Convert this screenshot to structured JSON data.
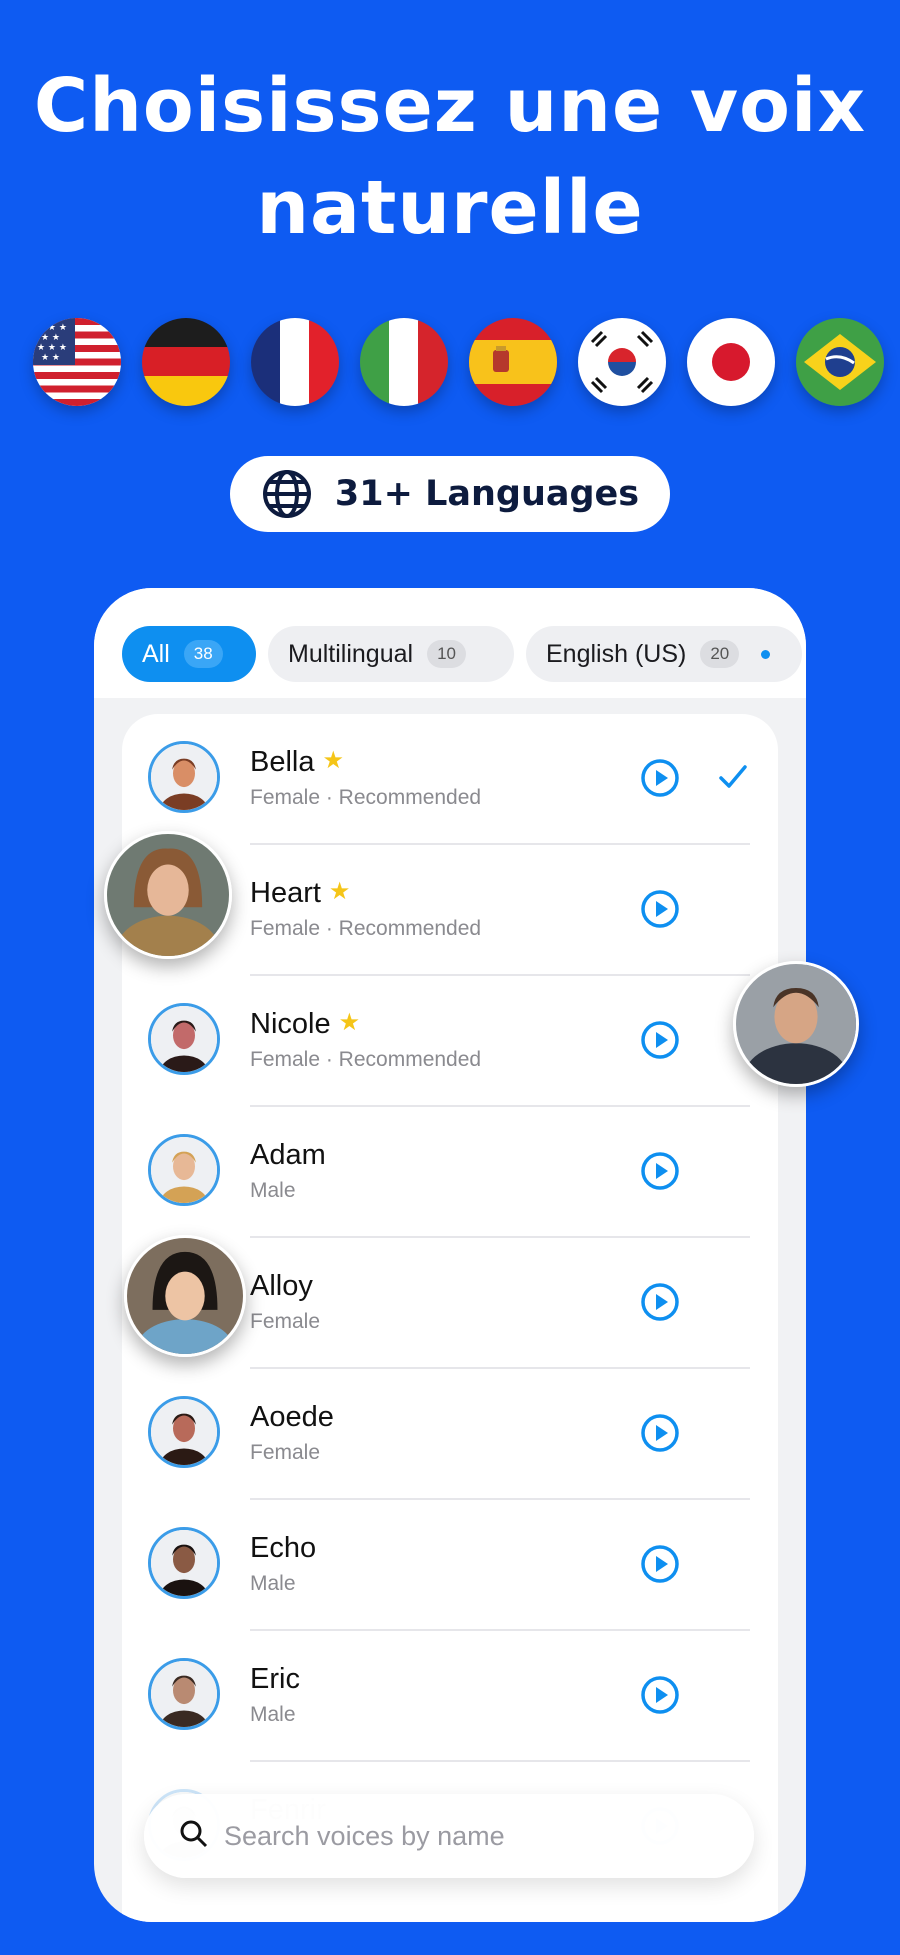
{
  "headline": {
    "line1": "Choisissez une voix",
    "line2": "naturelle"
  },
  "flags": [
    {
      "country": "United States"
    },
    {
      "country": "Germany"
    },
    {
      "country": "France"
    },
    {
      "country": "Italy"
    },
    {
      "country": "Spain"
    },
    {
      "country": "South Korea"
    },
    {
      "country": "Japan"
    },
    {
      "country": "Brazil"
    }
  ],
  "languages_pill": {
    "icon": "globe-icon",
    "label": "31+ Languages"
  },
  "filters": [
    {
      "label": "All",
      "count": "38",
      "active": true
    },
    {
      "label": "Multilingual",
      "count": "10",
      "active": false
    },
    {
      "label": "English (US)",
      "count": "20",
      "active": false
    }
  ],
  "voices": [
    {
      "name": "Bella",
      "detail": "Female · Recommended",
      "starred": true,
      "selected": true
    },
    {
      "name": "Heart",
      "detail": "Female · Recommended",
      "starred": true,
      "selected": false
    },
    {
      "name": "Nicole",
      "detail": "Female · Recommended",
      "starred": true,
      "selected": false
    },
    {
      "name": "Adam",
      "detail": "Male",
      "starred": false,
      "selected": false
    },
    {
      "name": "Alloy",
      "detail": "Female",
      "starred": false,
      "selected": false
    },
    {
      "name": "Aoede",
      "detail": "Female",
      "starred": false,
      "selected": false
    },
    {
      "name": "Echo",
      "detail": "Male",
      "starred": false,
      "selected": false
    },
    {
      "name": "Eric",
      "detail": "Male",
      "starred": false,
      "selected": false
    },
    {
      "name": "Fenrir",
      "detail": "",
      "starred": false,
      "selected": false
    }
  ],
  "search": {
    "placeholder": "Search voices by name",
    "icon": "search-icon"
  },
  "colors": {
    "background": "#0e5bf2",
    "accent": "#0e8ff0",
    "star": "#f5c518"
  }
}
